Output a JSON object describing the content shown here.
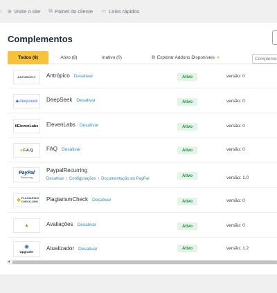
{
  "topbar": {
    "links": [
      {
        "icon": "globe-icon",
        "label": "Visite o site"
      },
      {
        "icon": "external-link-icon",
        "label": "Painel do cliente"
      },
      {
        "icon": "list-icon",
        "label": "Links rápidos"
      }
    ]
  },
  "page": {
    "title": "Complementos"
  },
  "tabs": [
    {
      "label": "Todos (8)"
    },
    {
      "label": "Ativo (8)"
    },
    {
      "label": "Inativo (0)"
    },
    {
      "label": "Explorar Addons Disponíveis"
    }
  ],
  "search": {
    "placeholder": "Complementos"
  },
  "addons": [
    {
      "logo": "ANTHROPIC",
      "name": "Antrópico",
      "action": "Desativar",
      "status": "Ativo",
      "version": "versão: 0"
    },
    {
      "logo": "deepseek",
      "name": "DeepSeek",
      "action": "Desativar",
      "status": "Ativo",
      "version": "versão: 0"
    },
    {
      "logo": "IIElevenLabs",
      "name": "ElevenLabs",
      "action": "Desativar",
      "status": "Ativo",
      "version": "versão: 0"
    },
    {
      "logo": "F.A.Q",
      "name": "FAQ",
      "action": "Desativar",
      "status": "Ativo",
      "version": "versão: 0"
    },
    {
      "logo": "PayPal",
      "logo_sub": "Recurring",
      "name": "PaypalRecurring",
      "links": [
        "Desativar",
        "Configurações",
        "Documentação do PayPal"
      ],
      "status": "Ativo",
      "version": "versão: 1.0"
    },
    {
      "logo": "PLAGIARISM CHECK.ORG",
      "name": "PlagiarismCheck",
      "action": "Desativar",
      "status": "Ativo",
      "version": "versão: 0"
    },
    {
      "logo": "",
      "name": "Avaliações",
      "action": "Desativar",
      "status": "Ativo",
      "version": "versão: 0"
    },
    {
      "logo": "Upgrader",
      "name": "Atualizador",
      "action": "Desativar",
      "status": "Ativo",
      "version": "versão: 1.2"
    }
  ],
  "colors": {
    "accent": "#f7c23c",
    "link": "#2b8dd6",
    "active_badge_bg": "#e3f5e7",
    "active_badge_text": "#1f8a3b"
  }
}
